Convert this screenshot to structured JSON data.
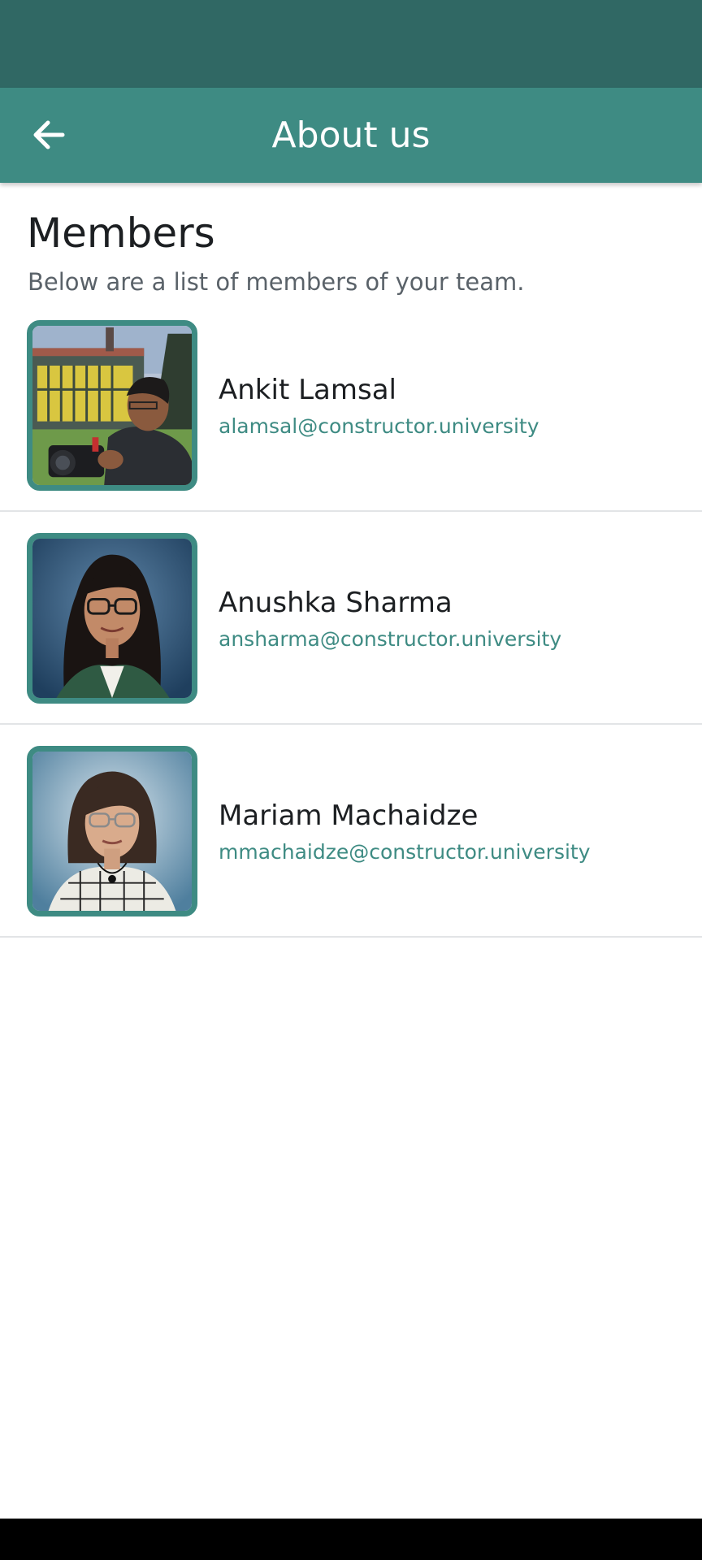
{
  "app_bar": {
    "title": "About us",
    "back_icon": "arrow-back-icon"
  },
  "section": {
    "title": "Members",
    "subtitle": "Below are a list of members of your team."
  },
  "members": [
    {
      "name": "Ankit Lamsal",
      "email": "alamsal@constructor.university",
      "avatar": "photo-man-with-camera"
    },
    {
      "name": "Anushka Sharma",
      "email": "ansharma@constructor.university",
      "avatar": "photo-woman-glasses"
    },
    {
      "name": "Mariam Machaidze",
      "email": "mmachaidze@constructor.university",
      "avatar": "photo-woman-checked-shirt"
    }
  ],
  "colors": {
    "status_bar": "#306864",
    "app_bar": "#3E8B83",
    "accent": "#3E8B83",
    "divider": "#e2e4e6"
  }
}
